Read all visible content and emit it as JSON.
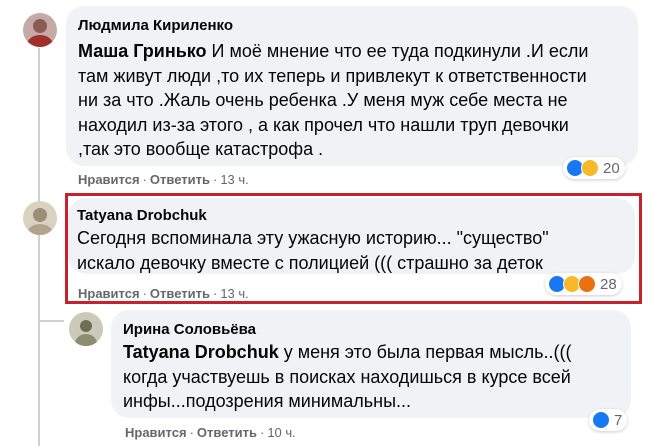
{
  "comments": [
    {
      "author": "Людмила Кириленко",
      "mention": "Маша Гринько",
      "lines": [
        " И моё мнение что ее туда подкинули .И если",
        "там живут люди ,то их теперь и привлекут к ответственности",
        "ни за что .Жаль очень ребенка .У меня муж себе места не",
        "находил из-за этого , а как прочел что нашли труп девочки",
        ",так это вообще катастрофа ."
      ],
      "reactions": {
        "icons": [
          "like-icon",
          "sad-icon"
        ],
        "count": "20"
      },
      "actions": {
        "like": "Нравится",
        "reply": "Ответить",
        "time": "13 ч."
      }
    },
    {
      "author": "Tatyana Drobchuk",
      "lines": [
        "Сегодня вспоминала эту ужасную историю... \"существо\"",
        "искало девочку вместе с полицией ((( страшно за деток"
      ],
      "reactions": {
        "icons": [
          "like-icon",
          "sad-icon",
          "angry-icon"
        ],
        "count": "28"
      },
      "actions": {
        "like": "Нравится",
        "reply": "Ответить",
        "time": "13 ч."
      }
    },
    {
      "author": "Ирина Соловьёва",
      "mention": "Tatyana Drobchuk",
      "lines": [
        " у меня это была первая мысль..(((",
        "когда участвуешь в поисках находишься в курсе всей",
        "инфы...подозрения минимальны..."
      ],
      "reactions": {
        "icons": [
          "like-icon"
        ],
        "count": "7"
      },
      "actions": {
        "like": "Нравится",
        "reply": "Ответить",
        "time": "10 ч."
      }
    }
  ],
  "colors": {
    "bubble": "#f0f2f5",
    "highlight": "#c8202c",
    "like": "#1877f2",
    "sad": "#f7b928",
    "angry": "#e9710f"
  }
}
